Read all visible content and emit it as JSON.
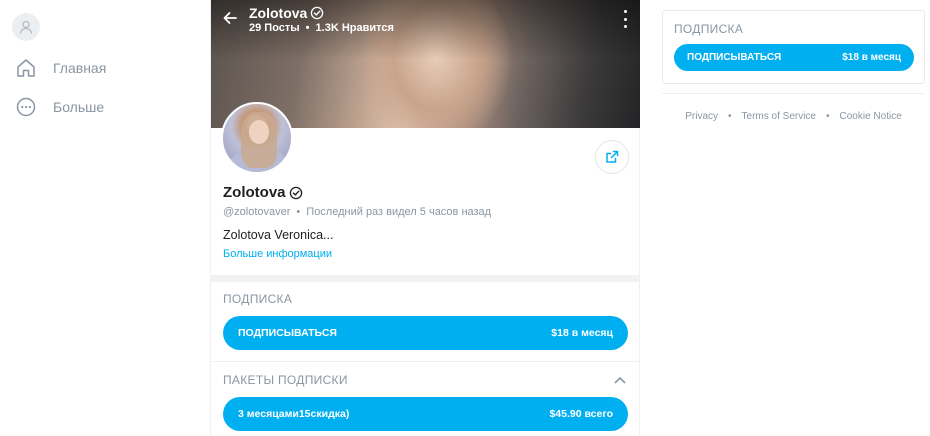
{
  "nav": {
    "items": [
      {
        "label": "Главная",
        "icon": "home-icon"
      },
      {
        "label": "Больше",
        "icon": "more-icon"
      }
    ]
  },
  "header": {
    "name": "Zolotova",
    "posts": "29 Посты",
    "likes": "1.3K Нравится"
  },
  "profile": {
    "name": "Zolotova",
    "handle": "@zolotovaver",
    "last_seen": "Последний раз видел 5 часов назад",
    "bio": "Zolotova Veronica...",
    "more_info": "Больше информации"
  },
  "subscription": {
    "title": "ПОДПИСКА",
    "button_label": "ПОДПИСЫВАТЬСЯ",
    "price": "$18 в месяц"
  },
  "bundles": {
    "title": "ПАКЕТЫ ПОДПИСКИ",
    "items": [
      {
        "label": "3 месяцами15скидка)",
        "price": "$45.90 всего"
      }
    ]
  },
  "sidebar_card": {
    "title": "ПОДПИСКА",
    "button_label": "ПОДПИСЫВАТЬСЯ",
    "price": "$18 в месяц"
  },
  "footer": {
    "links": [
      "Privacy",
      "Terms of Service",
      "Cookie Notice"
    ]
  },
  "colors": {
    "accent": "#00aff0",
    "muted": "#8a96a3",
    "text": "#1f1f1f"
  }
}
